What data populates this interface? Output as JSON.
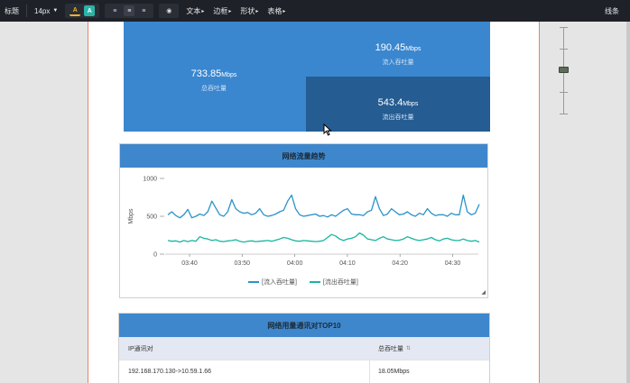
{
  "toolbar": {
    "title_label": "标题",
    "font_size": "14px",
    "text_menu": "文本",
    "border_menu": "边框",
    "shape_menu": "形状",
    "table_menu": "表格",
    "right_label": "线条"
  },
  "throughput": {
    "total_value": "733.85",
    "total_unit": "Mbps",
    "total_label": "总吞吐量",
    "in_value": "190.45",
    "in_unit": "Mbps",
    "in_label": "流入吞吐量",
    "out_value": "543.4",
    "out_unit": "Mbps",
    "out_label": "流出吞吐量"
  },
  "trend": {
    "title": "网络流量趋势",
    "legend_in": "[流入吞吐量]",
    "legend_out": "[流出吞吐量]"
  },
  "chart_data": {
    "type": "line",
    "ylabel": "Mbps",
    "ylim": [
      0,
      1000
    ],
    "yticks": [
      "1000",
      "500",
      "0"
    ],
    "xticks": [
      "03:40",
      "03:50",
      "04:00",
      "04:10",
      "04:20",
      "04:30"
    ],
    "series": [
      {
        "name": "[流入吞吐量]",
        "color": "#2a93c8",
        "values": [
          520,
          560,
          510,
          480,
          520,
          590,
          480,
          500,
          530,
          510,
          560,
          700,
          610,
          520,
          500,
          560,
          720,
          600,
          560,
          540,
          550,
          520,
          540,
          600,
          520,
          500,
          510,
          530,
          560,
          580,
          700,
          780,
          600,
          520,
          500,
          510,
          520,
          530,
          500,
          510,
          490,
          520,
          500,
          540,
          580,
          600,
          530,
          520,
          520,
          510,
          560,
          580,
          760,
          600,
          510,
          530,
          600,
          560,
          520,
          530,
          560,
          520,
          500,
          540,
          520,
          600,
          540,
          510,
          520,
          520,
          500,
          540,
          520,
          520,
          780,
          560,
          520,
          540,
          660
        ]
      },
      {
        "name": "[流出吞吐量]",
        "color": "#18b6a0",
        "values": [
          180,
          170,
          175,
          160,
          180,
          165,
          180,
          170,
          230,
          210,
          200,
          180,
          190,
          170,
          165,
          175,
          180,
          190,
          170,
          160,
          170,
          175,
          165,
          170,
          175,
          180,
          170,
          185,
          200,
          220,
          210,
          190,
          175,
          170,
          180,
          175,
          170,
          165,
          170,
          180,
          220,
          260,
          240,
          200,
          180,
          200,
          210,
          230,
          280,
          250,
          200,
          190,
          180,
          210,
          230,
          200,
          190,
          180,
          185,
          200,
          230,
          210,
          190,
          180,
          190,
          200,
          220,
          190,
          175,
          200,
          210,
          190,
          180,
          180,
          200,
          180,
          170,
          180,
          160
        ]
      }
    ]
  },
  "top10": {
    "title": "网络用量通讯对TOP10",
    "col_pair": "IP通讯对",
    "col_total": "总吞吐量",
    "sort_icon": "sort-icon",
    "rows": [
      {
        "pair": "192.168.170.130->10.59.1.66",
        "total": "18.05Mbps"
      }
    ]
  }
}
